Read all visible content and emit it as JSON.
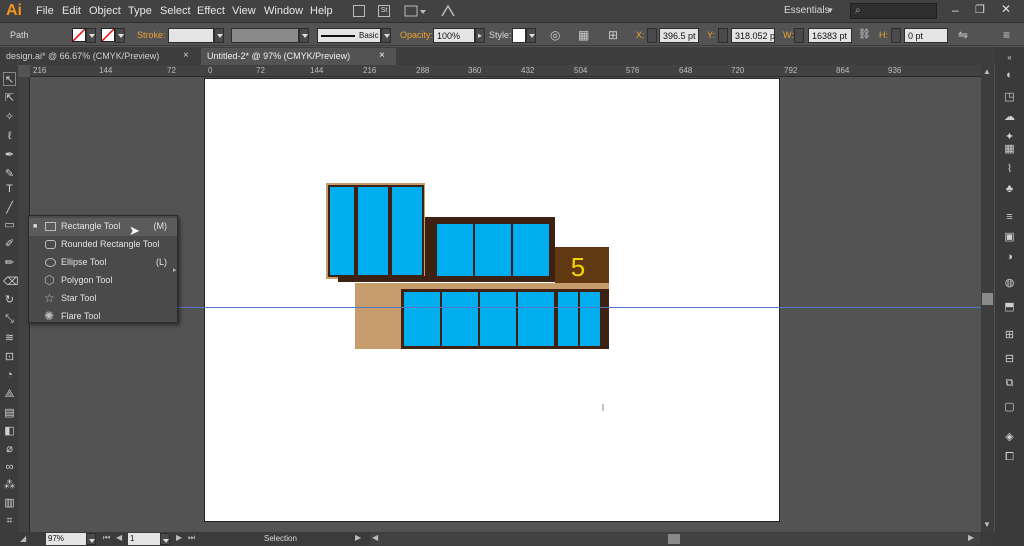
{
  "app": {
    "logo": "Ai",
    "menus": [
      "File",
      "Edit",
      "Object",
      "Type",
      "Select",
      "Effect",
      "View",
      "Window",
      "Help"
    ],
    "workspace": "Essentials",
    "search_placeholder": ""
  },
  "control": {
    "selection_label": "Path",
    "stroke_label": "Stroke:",
    "brush": "Basic",
    "opacity_label": "Opacity:",
    "opacity": "100%",
    "style_label": "Style:",
    "x_label": "X:",
    "x": "396.5 pt",
    "y_label": "Y:",
    "y": "318.052 pt",
    "w_label": "W:",
    "w": "16383 pt",
    "h_label": "H:",
    "h": "0 pt"
  },
  "tabs": [
    {
      "label": "design.ai* @ 66.67% (CMYK/Preview)"
    },
    {
      "label": "Untitled-2* @ 97% (CMYK/Preview)"
    }
  ],
  "ruler": {
    "ticks": [
      "216",
      "144",
      "72",
      "0",
      "72",
      "144",
      "216",
      "288",
      "360",
      "432",
      "504",
      "576",
      "648",
      "720",
      "792",
      "864",
      "936"
    ]
  },
  "flyout": {
    "items": [
      {
        "label": "Rectangle Tool",
        "key": "(M)"
      },
      {
        "label": "Rounded Rectangle Tool",
        "key": ""
      },
      {
        "label": "Ellipse Tool",
        "key": "(L)"
      },
      {
        "label": "Polygon Tool",
        "key": ""
      },
      {
        "label": "Star Tool",
        "key": ""
      },
      {
        "label": "Flare Tool",
        "key": ""
      }
    ]
  },
  "artwork": {
    "number": "5",
    "colors": {
      "glass": "#00aeef",
      "frame": "#3d2214",
      "wall": "#c69c6d",
      "number_fill": "#f5d300"
    }
  },
  "status": {
    "zoom": "97%",
    "page": "1",
    "mode": "Selection"
  }
}
